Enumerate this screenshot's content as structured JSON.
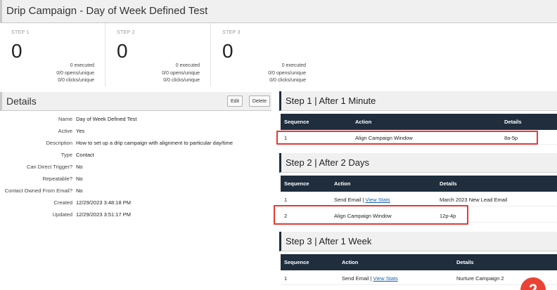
{
  "header": {
    "title": "Drip Campaign - Day of Week Defined Test"
  },
  "steps": [
    {
      "label": "STEP 1",
      "count": "0",
      "executed": "0 executed",
      "opens": "0/0 opens/unique",
      "clicks": "0/0 clicks/unique"
    },
    {
      "label": "STEP 2",
      "count": "0",
      "executed": "0 executed",
      "opens": "0/0 opens/unique",
      "clicks": "0/0 clicks/unique"
    },
    {
      "label": "STEP 3",
      "count": "0",
      "executed": "0 executed",
      "opens": "0/0 opens/unique",
      "clicks": "0/0 clicks/unique"
    }
  ],
  "details": {
    "title": "Details",
    "edit_label": "Edit",
    "delete_label": "Delete",
    "fields": [
      {
        "key": "Name",
        "value": "Day of Week Defined Test"
      },
      {
        "key": "Active",
        "value": "Yes"
      },
      {
        "key": "Description",
        "value": "How to set up a drip campaign with alignment to particular day/time"
      },
      {
        "key": "Type",
        "value": "Contact"
      },
      {
        "key": "Can Direct Trigger?",
        "value": "No"
      },
      {
        "key": "Repeatable?",
        "value": "No"
      },
      {
        "key": "Contact Owned From Email?",
        "value": "No"
      },
      {
        "key": "Created",
        "value": "12/29/2023 3:48:18 PM"
      },
      {
        "key": "Updated",
        "value": "12/29/2023 3:51:17 PM"
      }
    ]
  },
  "sections": [
    {
      "title": "Step 1 | After 1 Minute",
      "columns": [
        "Sequence",
        "Action",
        "Details"
      ],
      "rows": [
        {
          "sequence": "1",
          "action": "Align Campaign Window",
          "link": "",
          "details": "8a-5p"
        }
      ]
    },
    {
      "title": "Step 2 | After 2 Days",
      "columns": [
        "Sequence",
        "Action",
        "Details"
      ],
      "rows": [
        {
          "sequence": "1",
          "action": "Send Email | ",
          "link": "View Stats",
          "details": "March 2023 New Lead Email"
        },
        {
          "sequence": "2",
          "action": "Align Campaign Window",
          "link": "",
          "details": "12p-4p"
        }
      ]
    },
    {
      "title": "Step 3 | After 1 Week",
      "columns": [
        "Sequence",
        "Action",
        "Details"
      ],
      "rows": [
        {
          "sequence": "1",
          "action": "Send Email | ",
          "link": "View Stats",
          "details": "Nurture Campaign 2"
        }
      ]
    }
  ],
  "badge": {
    "text": "2"
  },
  "colors": {
    "header_dark": "#1f2d3d",
    "highlight": "#e53935",
    "link": "#1a5fb4",
    "badge": "#ea4335"
  }
}
